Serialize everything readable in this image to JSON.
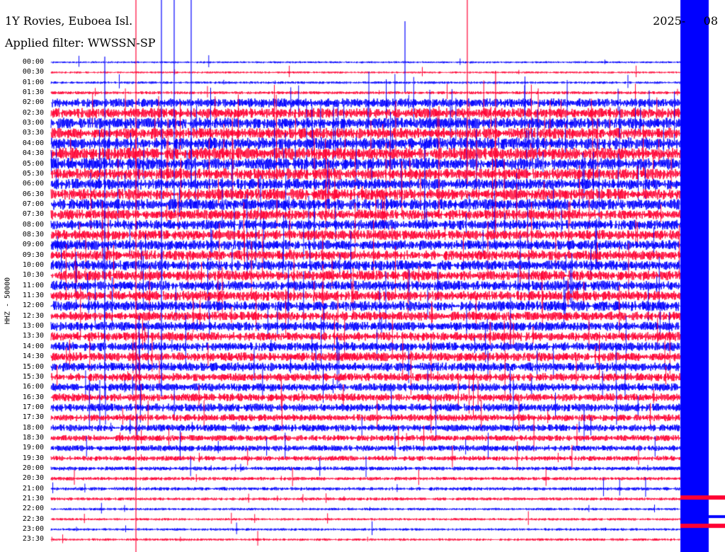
{
  "header": {
    "station": "1Y Rovies, Euboea Isl.",
    "filter": "Applied filter: WWSSN-SP",
    "date": "2025-     08"
  },
  "chart_data": {
    "type": "helicorder",
    "title": "1Y Rovies, Euboea Isl.",
    "subtitle": "Applied filter: WWSSN-SP",
    "ylabel": "HHZ - 50000",
    "tick_labels": [
      "00:00",
      "00:30",
      "01:00",
      "01:30",
      "02:00",
      "02:30",
      "03:00",
      "03:30",
      "04:00",
      "04:30",
      "05:00",
      "05:30",
      "06:00",
      "06:30",
      "07:00",
      "07:30",
      "08:00",
      "08:30",
      "09:00",
      "09:30",
      "10:00",
      "10:30",
      "11:00",
      "11:30",
      "12:00",
      "12:30",
      "13:00",
      "13:30",
      "14:00",
      "14:30",
      "15:00",
      "15:30",
      "16:00",
      "16:30",
      "17:00",
      "17:30",
      "18:00",
      "18:30",
      "19:00",
      "19:30",
      "20:00",
      "20:30",
      "21:00",
      "21:30",
      "22:00",
      "22:30",
      "23:00",
      "23:30"
    ],
    "line_colors": [
      "#0000ff",
      "#ff0033"
    ],
    "trace_amplitude": [
      0.2,
      0.2,
      0.25,
      0.3,
      0.9,
      1.0,
      1.1,
      1.1,
      1.2,
      1.2,
      1.2,
      1.1,
      1.1,
      1.1,
      1.1,
      1.0,
      1.0,
      1.0,
      1.0,
      1.0,
      1.0,
      1.0,
      1.0,
      1.0,
      1.0,
      0.9,
      0.9,
      0.9,
      0.9,
      0.9,
      0.9,
      0.8,
      0.8,
      0.8,
      0.8,
      0.7,
      0.7,
      0.6,
      0.6,
      0.5,
      0.4,
      0.35,
      0.35,
      0.3,
      0.25,
      0.25,
      0.25,
      0.25
    ],
    "grid": false
  }
}
